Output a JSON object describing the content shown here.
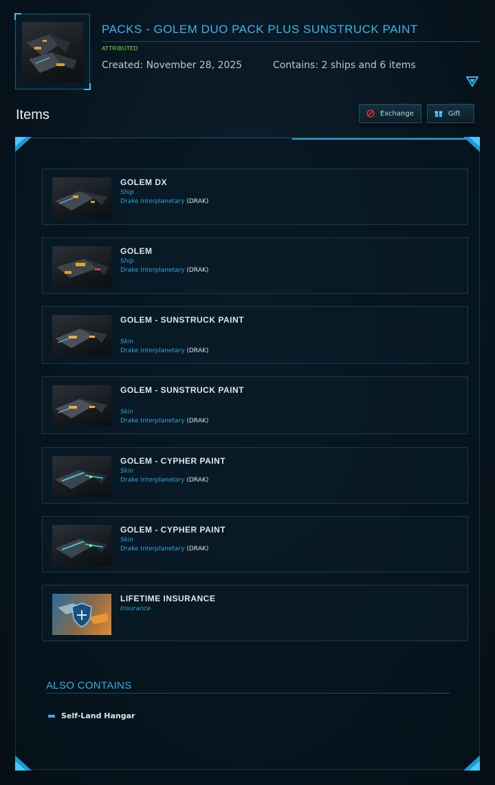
{
  "pack": {
    "title": "PACKS - GOLEM DUO PACK PLUS SUNSTRUCK PAINT",
    "status": "ATTRIBUTED",
    "created": "Created: November 28, 2025",
    "contains": "Contains: 2 ships and 6 items",
    "status_color": "#7fe03a",
    "accent_color": "#39b8ea"
  },
  "items_section": {
    "title": "Items",
    "exchange_label": "Exchange",
    "gift_label": "Gift",
    "exchange_icon": "no-entry-icon",
    "gift_icon": "gift-box-icon"
  },
  "items": [
    {
      "name": "GOLEM DX",
      "kind": "Ship",
      "maker": "Drake Interplanetary",
      "code": "DRAK",
      "thumb": "golem-dx-ship"
    },
    {
      "name": "GOLEM",
      "kind": "Ship",
      "maker": "Drake Interplanetary",
      "code": "DRAK",
      "thumb": "golem-ship"
    },
    {
      "name": "GOLEM - SUNSTRUCK PAINT",
      "kind": "Skin",
      "maker": "Drake Interplanetary",
      "code": "DRAK",
      "thumb": "golem-sunstruck"
    },
    {
      "name": "GOLEM - SUNSTRUCK PAINT",
      "kind": "Skin",
      "maker": "Drake Interplanetary",
      "code": "DRAK",
      "thumb": "golem-sunstruck"
    },
    {
      "name": "GOLEM - CYPHER PAINT",
      "kind": "Skin",
      "maker": "Drake Interplanetary",
      "code": "DRAK",
      "thumb": "golem-cypher"
    },
    {
      "name": "GOLEM - CYPHER PAINT",
      "kind": "Skin",
      "maker": "Drake Interplanetary",
      "code": "DRAK",
      "thumb": "golem-cypher"
    },
    {
      "name": "LIFETIME INSURANCE",
      "kind": "Insurance",
      "maker": "",
      "code": "",
      "thumb": "insurance-shield"
    }
  ],
  "also_contains": {
    "title": "ALSO CONTAINS",
    "items": [
      "Self-Land Hangar"
    ]
  }
}
